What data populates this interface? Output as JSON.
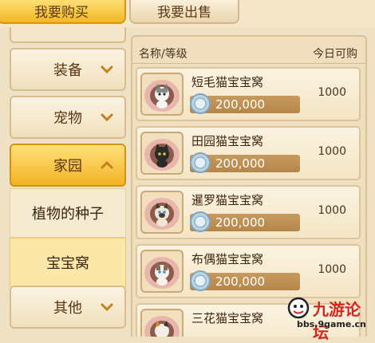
{
  "tabs": {
    "buy_label": "我要购买",
    "sell_label": "我要出售"
  },
  "sidebar": {
    "equipment_label": "装备",
    "pets_label": "宠物",
    "home_label": "家园",
    "home_sub": [
      "植物的种子",
      "宝宝窝"
    ],
    "other_label": "其他"
  },
  "list": {
    "header_name": "名称/等级",
    "header_today": "今日可购",
    "items": [
      {
        "name": "短毛猫宝宝窝",
        "price": "200,000",
        "qty": "1000",
        "cat": "white-grey"
      },
      {
        "name": "田园猫宝宝窝",
        "price": "200,000",
        "qty": "1000",
        "cat": "black"
      },
      {
        "name": "暹罗猫宝宝窝",
        "price": "200,000",
        "qty": "1000",
        "cat": "siamese"
      },
      {
        "name": "布偶猫宝宝窝",
        "price": "200,000",
        "qty": "1000",
        "cat": "ragdoll"
      },
      {
        "name": "三花猫宝宝窝",
        "price": "",
        "qty": "",
        "cat": "calico"
      }
    ]
  },
  "watermark": {
    "title": "九游论坛",
    "url": "bbs.9game.cn"
  },
  "colors": {
    "accent": "#f3b724",
    "panel": "#efdfbe",
    "price_bar": "#c69a5e"
  }
}
